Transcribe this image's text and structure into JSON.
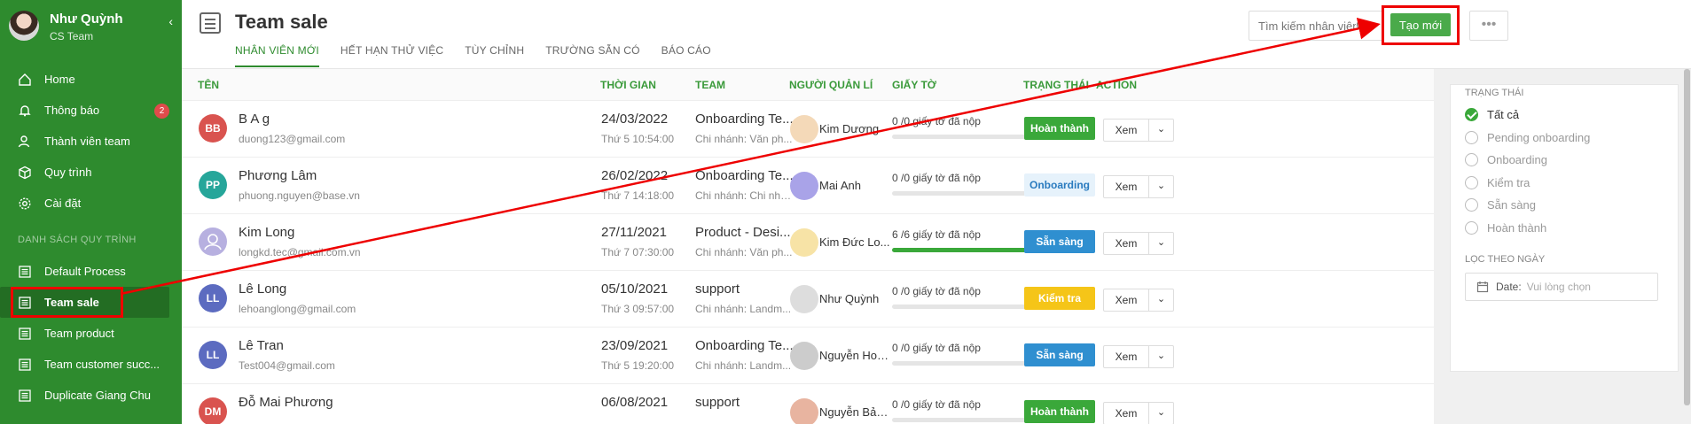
{
  "sidebar": {
    "user_name": "Như Quỳnh",
    "user_team": "CS Team",
    "collapse_glyph": "‹",
    "nav": [
      {
        "label": "Home",
        "icon": "home-icon"
      },
      {
        "label": "Thông báo",
        "icon": "bell-icon",
        "badge": "2"
      },
      {
        "label": "Thành viên team",
        "icon": "user-icon"
      },
      {
        "label": "Quy trình",
        "icon": "cube-icon"
      },
      {
        "label": "Cài đặt",
        "icon": "gear-icon"
      }
    ],
    "flow_section_title": "DANH SÁCH QUY TRÌNH",
    "flows": [
      {
        "label": "Default Process",
        "active": false
      },
      {
        "label": "Team sale",
        "active": true
      },
      {
        "label": "Team product",
        "active": false
      },
      {
        "label": "Team customer succ...",
        "active": false
      },
      {
        "label": "Duplicate Giang Chu",
        "active": false
      }
    ]
  },
  "header": {
    "title": "Team sale",
    "tabs": [
      "NHÂN VIÊN MỚI",
      "HẾT HẠN THỬ VIỆC",
      "TÙY CHỈNH",
      "TRƯỜNG SẴN CÓ",
      "BÁO CÁO"
    ],
    "active_tab": 0,
    "search_placeholder": "Tìm kiếm nhân viên",
    "create_label": "Tạo mới",
    "more_label": "•••"
  },
  "table": {
    "columns": [
      "TÊN",
      "THỜI GIAN",
      "TEAM",
      "NGƯỜI QUẢN LÍ",
      "GIẤY TỜ",
      "TRẠNG THÁI",
      "ACTION"
    ],
    "rows": [
      {
        "initials": "BB",
        "avatar_color": "#d9534f",
        "name": "B A g",
        "email": "duong123@gmail.com",
        "date": "24/03/2022",
        "time": "Thứ 5 10:54:00",
        "team": "Onboarding Te...",
        "branch": "Chi nhánh: Văn ph...",
        "manager": "Kim Dương",
        "docs": "0 /0 giấy tờ đã nộp",
        "progress": 0,
        "status": "Hoàn thành",
        "status_bg": "#3aa83a",
        "status_fg": "#ffffff",
        "view": "Xem"
      },
      {
        "initials": "PP",
        "avatar_color": "#26a69a",
        "name": "Phương Lâm",
        "email": "phuong.nguyen@base.vn",
        "date": "26/02/2022",
        "time": "Thứ 7 14:18:00",
        "team": "Onboarding Te...",
        "branch": "Chi nhánh: Chi nhá...",
        "manager": "Mai Anh",
        "docs": "0 /0 giấy tờ đã nộp",
        "progress": 0,
        "status": "Onboarding",
        "status_bg": "#e6f2fb",
        "status_fg": "#2a7bbf",
        "view": "Xem"
      },
      {
        "initials": "",
        "avatar_color": "#b7b0e0",
        "name": "Kim Long",
        "email": "longkd.tec@gmail.com.vn",
        "date": "27/11/2021",
        "time": "Thứ 7 07:30:00",
        "team": "Product - Desi...",
        "branch": "Chi nhánh: Văn ph...",
        "manager": "Kim Đức Lo...",
        "docs": "6 /6 giấy tờ đã nộp",
        "progress": 1,
        "status": "Sẵn sàng",
        "status_bg": "#2f8fd0",
        "status_fg": "#ffffff",
        "view": "Xem"
      },
      {
        "initials": "LL",
        "avatar_color": "#5c6bc0",
        "name": "Lê Long",
        "email": "lehoanglong@gmail.com",
        "date": "05/10/2021",
        "time": "Thứ 3 09:57:00",
        "team": "support",
        "branch": "Chi nhánh: Landm...",
        "manager": "Như Quỳnh",
        "docs": "0 /0 giấy tờ đã nộp",
        "progress": 0,
        "status": "Kiểm tra",
        "status_bg": "#f5c518",
        "status_fg": "#ffffff",
        "view": "Xem"
      },
      {
        "initials": "LL",
        "avatar_color": "#5c6bc0",
        "name": "Lê Tran",
        "email": "Test004@gmail.com",
        "date": "23/09/2021",
        "time": "Thứ 5 19:20:00",
        "team": "Onboarding Te...",
        "branch": "Chi nhánh: Landm...",
        "manager": "Nguyễn Hoà...",
        "docs": "0 /0 giấy tờ đã nộp",
        "progress": 0,
        "status": "Sẵn sàng",
        "status_bg": "#2f8fd0",
        "status_fg": "#ffffff",
        "view": "Xem"
      },
      {
        "initials": "DM",
        "avatar_color": "#d9534f",
        "name": "Đỗ Mai Phương",
        "email": "",
        "date": "06/08/2021",
        "time": "",
        "team": "support",
        "branch": "",
        "manager": "Nguyễn Bảo...",
        "docs": "0 /0 giấy tờ đã nộp",
        "progress": 0,
        "status": "Hoàn thành",
        "status_bg": "#3aa83a",
        "status_fg": "#ffffff",
        "view": "Xem"
      }
    ]
  },
  "filter": {
    "status_title": "TRẠNG THÁI",
    "options": [
      "Tất cả",
      "Pending onboarding",
      "Onboarding",
      "Kiểm tra",
      "Sẵn sàng",
      "Hoàn thành"
    ],
    "selected": 0,
    "date_title": "LỌC THEO NGÀY",
    "date_label": "Date:",
    "date_placeholder": "Vui lòng chọn"
  },
  "colors": {
    "sidebar": "#2e8b2e",
    "accent": "#3aa83a",
    "highlight": "#ee0000"
  }
}
